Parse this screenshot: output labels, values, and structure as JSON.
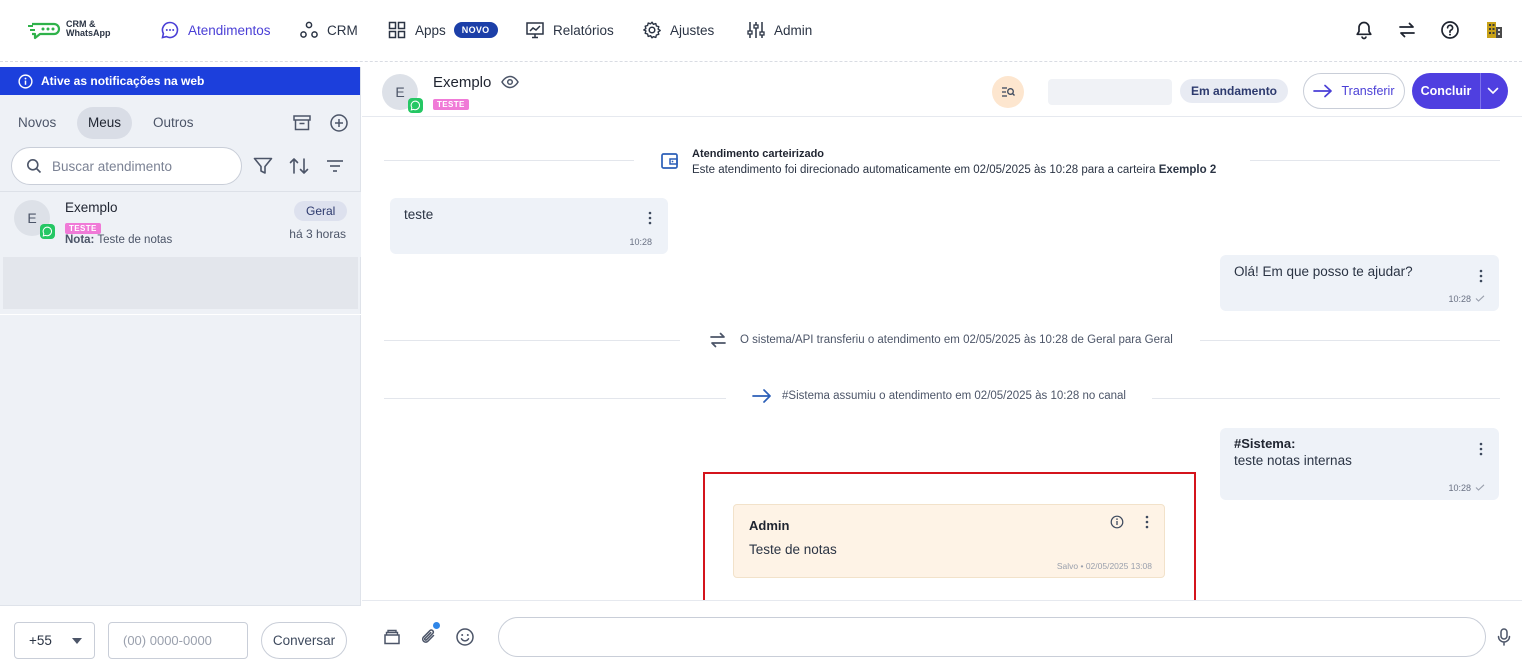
{
  "brand": {
    "line1": "CRM &",
    "line2": "WhatsApp"
  },
  "nav": {
    "atendimentos": "Atendimentos",
    "crm": "CRM",
    "apps": "Apps",
    "apps_badge": "NOVO",
    "relatorios": "Relatórios",
    "ajustes": "Ajustes",
    "admin": "Admin"
  },
  "notification_bar": "Ative as notificações na web",
  "tabs": {
    "novos": "Novos",
    "meus": "Meus",
    "outros": "Outros"
  },
  "search": {
    "placeholder": "Buscar atendimento"
  },
  "conversation": {
    "avatar": "E",
    "name": "Exemplo",
    "tag": "TESTE",
    "note_label": "Nota:",
    "note_text": "Teste de notas",
    "queue": "Geral",
    "time": "há 3 horas"
  },
  "new_chat": {
    "ddi": "+55",
    "phone_placeholder": "(00) 0000-0000",
    "button": "Conversar"
  },
  "chat_header": {
    "avatar": "E",
    "name": "Exemplo",
    "tag": "TESTE",
    "status": "Em andamento",
    "transfer": "Transferir",
    "conclude": "Concluir"
  },
  "messages": {
    "wallet_title": "Atendimento carteirizado",
    "wallet_text": "Este atendimento foi direcionado automaticamente em 02/05/2025 às 10:28 para a carteira",
    "wallet_name": "Exemplo 2",
    "incoming1_text": "teste",
    "incoming1_time": "10:28",
    "outgoing1_text": "Olá! Em que posso te ajudar?",
    "outgoing1_time": "10:28",
    "transfer_text": "O sistema/API transferiu o atendimento em 02/05/2025 às 10:28 de Geral para Geral",
    "assume_text": "#Sistema assumiu o atendimento em 02/05/2025 às 10:28 no canal",
    "outgoing2_author": "#Sistema:",
    "outgoing2_text": "teste notas internas",
    "outgoing2_time": "10:28",
    "note_author": "Admin",
    "note_text": "Teste de notas",
    "note_meta": "Salvo • 02/05/2025 13:08"
  },
  "colors": {
    "accent": "#4f3fe0",
    "notification_bar": "#1c3fdc",
    "note_background": "#fef3e6",
    "highlight": "#d4141c",
    "tag": "#f07ad7",
    "whatsapp": "#25c764"
  }
}
